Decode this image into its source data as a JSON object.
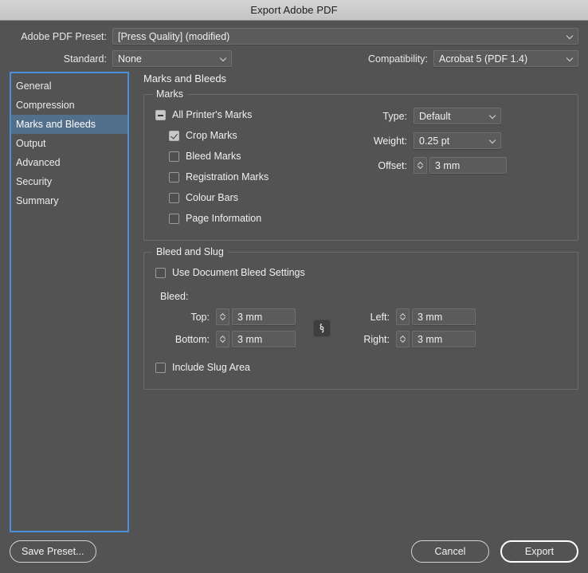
{
  "window": {
    "title": "Export Adobe PDF"
  },
  "header": {
    "preset_label": "Adobe PDF Preset:",
    "preset_value": "[Press Quality] (modified)",
    "standard_label": "Standard:",
    "standard_value": "None",
    "compatibility_label": "Compatibility:",
    "compatibility_value": "Acrobat 5 (PDF 1.4)"
  },
  "sidebar": {
    "items": [
      {
        "label": "General",
        "selected": false
      },
      {
        "label": "Compression",
        "selected": false
      },
      {
        "label": "Marks and Bleeds",
        "selected": true
      },
      {
        "label": "Output",
        "selected": false
      },
      {
        "label": "Advanced",
        "selected": false
      },
      {
        "label": "Security",
        "selected": false
      },
      {
        "label": "Summary",
        "selected": false
      }
    ],
    "selection_color": "#52708c",
    "focus_ring_color": "#4a90d9"
  },
  "panel": {
    "title": "Marks and Bleeds",
    "marks_group": {
      "legend": "Marks",
      "checkboxes": [
        {
          "label": "All Printer's Marks",
          "state": "mixed",
          "indent": false
        },
        {
          "label": "Crop Marks",
          "state": "checked",
          "indent": true
        },
        {
          "label": "Bleed Marks",
          "state": "unchecked",
          "indent": true
        },
        {
          "label": "Registration Marks",
          "state": "unchecked",
          "indent": true
        },
        {
          "label": "Colour Bars",
          "state": "unchecked",
          "indent": true
        },
        {
          "label": "Page Information",
          "state": "unchecked",
          "indent": true
        }
      ],
      "type_label": "Type:",
      "type_value": "Default",
      "weight_label": "Weight:",
      "weight_value": "0.25 pt",
      "offset_label": "Offset:",
      "offset_value": "3 mm"
    },
    "bleed_group": {
      "legend": "Bleed and Slug",
      "use_document_bleed_label": "Use Document Bleed Settings",
      "use_document_bleed_state": "unchecked",
      "bleed_label": "Bleed:",
      "top_label": "Top:",
      "top_value": "3 mm",
      "bottom_label": "Bottom:",
      "bottom_value": "3 mm",
      "left_label": "Left:",
      "left_value": "3 mm",
      "right_label": "Right:",
      "right_value": "3 mm",
      "link_icon": "chain-link-icon",
      "include_slug_label": "Include Slug Area",
      "include_slug_state": "unchecked"
    }
  },
  "footer": {
    "save_preset_label": "Save Preset...",
    "cancel_label": "Cancel",
    "export_label": "Export"
  }
}
